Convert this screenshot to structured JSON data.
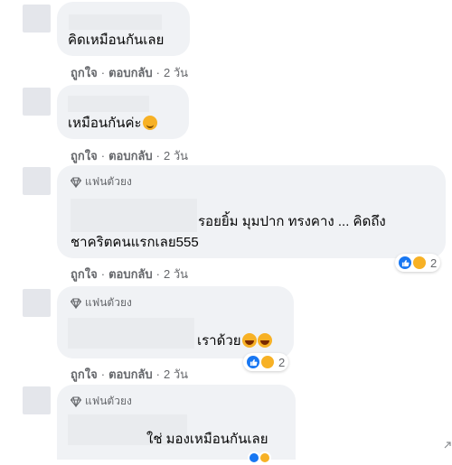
{
  "actions": {
    "like": "ถูกใจ",
    "reply": "ตอบกลับ",
    "separator": "·"
  },
  "badge": {
    "label": "แฟนตัวยง",
    "icon": "diamond-icon"
  },
  "comments": [
    {
      "text": "คิดเหมือนกันเลย",
      "time": "2 วัน"
    },
    {
      "text": "เหมือนกันค่ะ",
      "emoji": "smiling-face-icon",
      "time": "2 วัน"
    },
    {
      "text_line1": "รอยยิ้ม มุมปาก ทรงคาง ... คิดถึง",
      "text_line2": "ชาคริตคนแรกเลย555",
      "time": "2 วัน",
      "reactions": {
        "icons": [
          "like-reaction-icon",
          "haha-reaction-icon"
        ],
        "count": "2"
      }
    },
    {
      "text": "เราด้วย",
      "emoji": "laughing-face-icon",
      "time": "2 วัน",
      "reactions": {
        "icons": [
          "like-reaction-icon",
          "haha-reaction-icon"
        ],
        "count": "2"
      }
    },
    {
      "text": "ใช่ มองเหมือนกันเลย",
      "reactions": {
        "icons": [
          "haha-reaction-icon"
        ]
      }
    }
  ],
  "colors": {
    "bubble": "#f0f2f5",
    "like": "#1877f2",
    "haha": "#f7b125",
    "meta": "#65676b"
  }
}
